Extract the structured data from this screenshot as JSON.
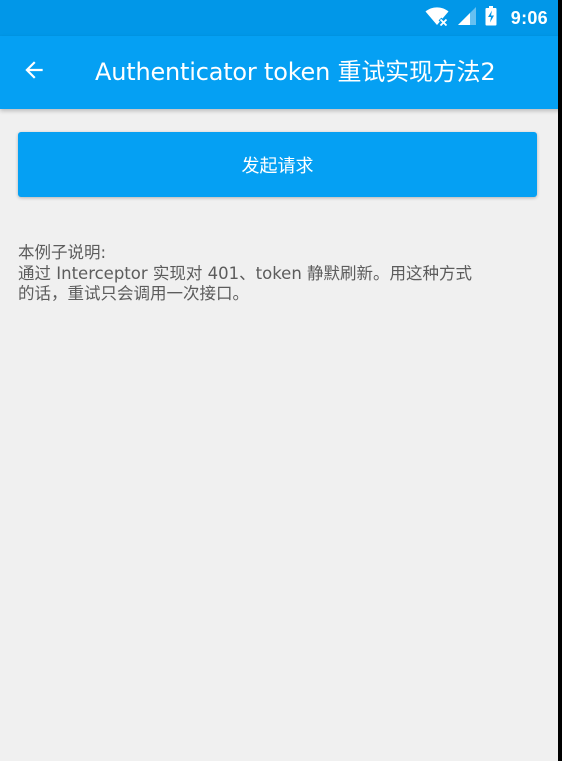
{
  "status_bar": {
    "time": "9:06",
    "background": "#0197e8",
    "icons": [
      "wifi-icon",
      "signal-icon",
      "battery-icon"
    ]
  },
  "app_bar": {
    "title": "Authenticator token 重试实现方法2",
    "back_icon": "arrow-left-icon",
    "background": "#05a0f3"
  },
  "main": {
    "request_button_label": "发起请求",
    "description": {
      "heading": "本例子说明:",
      "line1": "通过 Interceptor 实现对 401、token 静默刷新。用这种方式",
      "line2": "的话，重试只会调用一次接口。"
    }
  },
  "colors": {
    "accent": "#05a0f3",
    "page_background": "#f0f0f0",
    "text": "#5c5c5c"
  }
}
